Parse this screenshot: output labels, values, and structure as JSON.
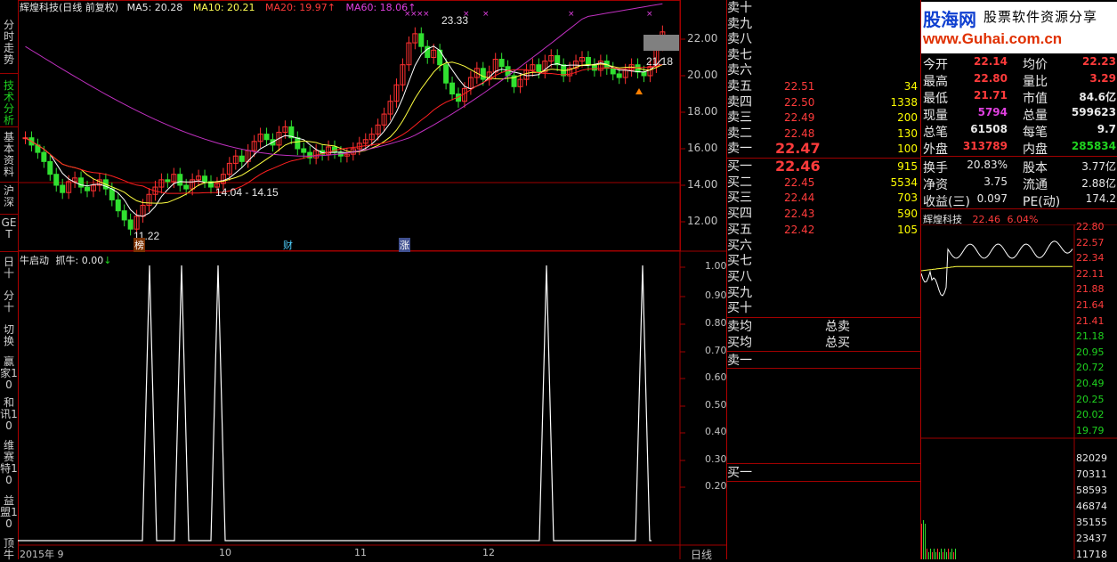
{
  "left_nav": [
    {
      "label": "分时走势",
      "active": false
    },
    {
      "label": "技术分析",
      "active": true
    },
    {
      "label": "基本资料",
      "active": false
    },
    {
      "label": "沪深",
      "active": false
    },
    {
      "label": "GET",
      "active": false
    }
  ],
  "left_nav_lower": [
    {
      "label": "日十"
    },
    {
      "label": "分十"
    },
    {
      "label": "切换"
    },
    {
      "label": "赢家10"
    },
    {
      "label": "和讯10"
    },
    {
      "label": "维赛特10"
    },
    {
      "label": "益盟10"
    },
    {
      "label": "顶牛"
    }
  ],
  "main_header": {
    "title": "辉煌科技(日线 前复权)",
    "ma5": "MA5: 20.28",
    "ma10": "MA10: 20.21",
    "ma20": "MA20: 19.97",
    "ma60": "MA60: 18.06"
  },
  "price_axis": [
    "22.00",
    "20.00",
    "18.00",
    "16.00",
    "14.00",
    "12.00"
  ],
  "price_annotations": {
    "high": "23.33",
    "low": "11.22",
    "range": "14.04 - 14.15",
    "last": "21.18"
  },
  "event_markers": [
    "榜",
    "财",
    "涨"
  ],
  "indicator_header": {
    "name": "牛启动",
    "value": "抓牛: 0.00"
  },
  "indicator_axis": [
    "1.00",
    "0.90",
    "0.80",
    "0.70",
    "0.60",
    "0.50",
    "0.40",
    "0.30",
    "0.20"
  ],
  "date_axis": [
    "2015年 9",
    "10",
    "11",
    "12"
  ],
  "period_label": "日线",
  "order_book": {
    "sells": [
      {
        "label": "卖十",
        "price": "",
        "vol": ""
      },
      {
        "label": "卖九",
        "price": "",
        "vol": ""
      },
      {
        "label": "卖八",
        "price": "",
        "vol": ""
      },
      {
        "label": "卖七",
        "price": "",
        "vol": ""
      },
      {
        "label": "卖六",
        "price": "",
        "vol": ""
      },
      {
        "label": "卖五",
        "price": "22.51",
        "vol": "34"
      },
      {
        "label": "卖四",
        "price": "22.50",
        "vol": "1338"
      },
      {
        "label": "卖三",
        "price": "22.49",
        "vol": "200"
      },
      {
        "label": "卖二",
        "price": "22.48",
        "vol": "130"
      },
      {
        "label": "卖一",
        "price": "22.47",
        "vol": "100"
      }
    ],
    "buys": [
      {
        "label": "买一",
        "price": "22.46",
        "vol": "915"
      },
      {
        "label": "买二",
        "price": "22.45",
        "vol": "5534"
      },
      {
        "label": "买三",
        "price": "22.44",
        "vol": "703"
      },
      {
        "label": "买四",
        "price": "22.43",
        "vol": "590"
      },
      {
        "label": "买五",
        "price": "22.42",
        "vol": "105"
      },
      {
        "label": "买六",
        "price": "",
        "vol": ""
      },
      {
        "label": "买七",
        "price": "",
        "vol": ""
      },
      {
        "label": "买八",
        "price": "",
        "vol": ""
      },
      {
        "label": "买九",
        "price": "",
        "vol": ""
      },
      {
        "label": "买十",
        "price": "",
        "vol": ""
      }
    ],
    "sell_avg_label": "卖均",
    "total_sell_label": "总卖",
    "buy_avg_label": "买均",
    "total_buy_label": "总买",
    "detail_sell_label": "卖一",
    "detail_buy_label": "买一"
  },
  "brand": {
    "name": "股海网",
    "slogan": "股票软件资源分享",
    "url": "www.Guhai.com.cn"
  },
  "quote": [
    {
      "l1": "今开",
      "v1": "22.14",
      "c1": "red",
      "l2": "均价",
      "v2": "22.23",
      "c2": "red"
    },
    {
      "l1": "最高",
      "v1": "22.80",
      "c1": "red",
      "l2": "量比",
      "v2": "3.29",
      "c2": "red"
    },
    {
      "l1": "最低",
      "v1": "21.71",
      "c1": "red",
      "l2": "市值",
      "v2": "84.6亿",
      "c2": "white"
    },
    {
      "l1": "现量",
      "v1": "5794",
      "c1": "magenta",
      "l2": "总量",
      "v2": "599623",
      "c2": "white"
    },
    {
      "l1": "总笔",
      "v1": "61508",
      "c1": "white",
      "l2": "每笔",
      "v2": "9.7",
      "c2": "white"
    },
    {
      "l1": "外盘",
      "v1": "313789",
      "c1": "red",
      "l2": "内盘",
      "v2": "285834",
      "c2": "green"
    }
  ],
  "fundamentals": [
    {
      "l1": "换手",
      "v1": "20.83%",
      "l2": "股本",
      "v2": "3.77亿"
    },
    {
      "l1": "净资",
      "v1": "3.75",
      "l2": "流通",
      "v2": "2.88亿"
    },
    {
      "l1": "收益(三)",
      "v1": "0.097",
      "l2": "PE(动)",
      "v2": "174.2"
    }
  ],
  "mini_chart": {
    "title": "辉煌科技",
    "price": "22.46",
    "change": "6.04%",
    "price_axis": [
      "22.80",
      "22.57",
      "22.34",
      "22.11",
      "21.88",
      "21.64",
      "21.41",
      "21.18",
      "20.95",
      "20.72",
      "20.49",
      "20.25",
      "20.02",
      "19.79"
    ],
    "vol_axis": [
      "82029",
      "70311",
      "58593",
      "46874",
      "35155",
      "23437",
      "11718"
    ]
  },
  "chart_data": {
    "type": "line",
    "indicator_spikes_x": [
      "spike1",
      "spike2",
      "spike3",
      "spike4",
      "spike5"
    ]
  }
}
